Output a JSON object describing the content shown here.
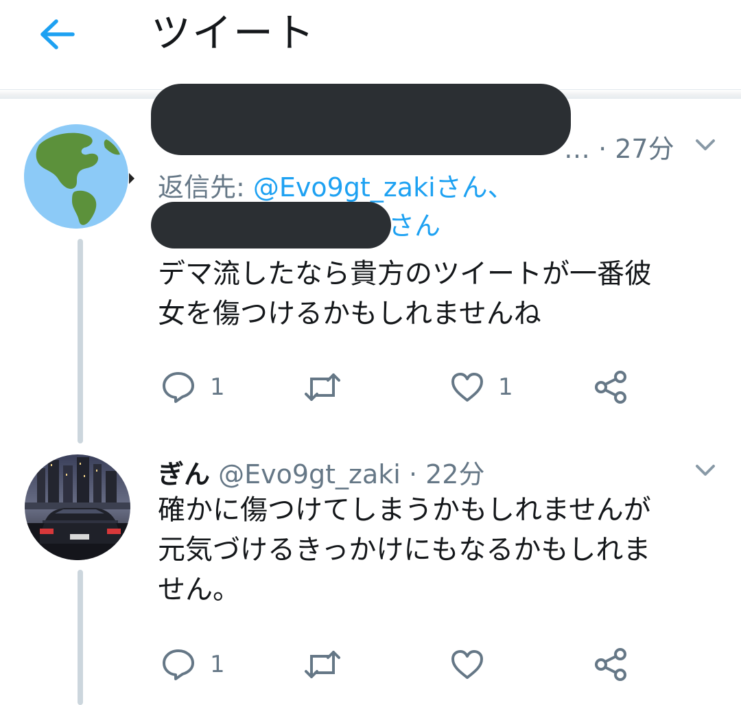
{
  "header": {
    "title": "ツイート"
  },
  "tweets": [
    {
      "time": "27分",
      "reply_prefix": "返信先: ",
      "reply_mention": "@Evo9gt_zakiさん、",
      "reply_line2_suffix": "さん",
      "text_line1": "デマ流したなら貴方のツイートが一番彼",
      "text_line2": "女を傷つけるかもしれませんね",
      "actions": {
        "reply_count": "1",
        "like_count": "1"
      }
    },
    {
      "display_name": "ぎん",
      "handle": "@Evo9gt_zaki",
      "time": "22分",
      "text_line1": "確かに傷つけてしまうかもしれませんが",
      "text_line2": "元気づけるきっかけにもなるかもしれま",
      "text_line3": "せん。",
      "actions": {
        "reply_count": "1"
      }
    }
  ],
  "colors": {
    "accent": "#1da1f2",
    "secondary_text": "#657786",
    "redaction": "#2b2f33",
    "thread_line": "#ccd6dd"
  }
}
